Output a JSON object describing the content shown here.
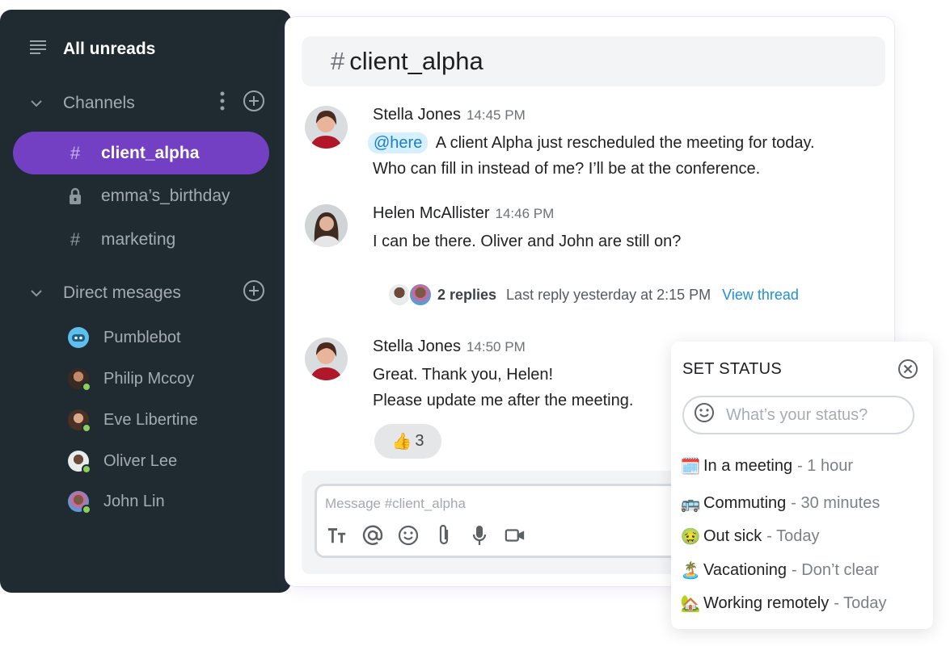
{
  "sidebar": {
    "all_unreads": "All unreads",
    "channels_header": "Channels",
    "channels": [
      {
        "label": "client_alpha",
        "icon": "hash-icon",
        "active": true
      },
      {
        "label": "emma’s_birthday",
        "icon": "lock-icon",
        "active": false
      },
      {
        "label": "marketing",
        "icon": "hash-icon",
        "active": false
      }
    ],
    "dm_header": "Direct mesages",
    "dms": [
      {
        "label": "Pumblebot"
      },
      {
        "label": "Philip Mccoy"
      },
      {
        "label": "Eve Libertine"
      },
      {
        "label": "Oliver Lee"
      },
      {
        "label": "John Lin"
      }
    ]
  },
  "chat": {
    "channel_hash": "#",
    "channel_name": "client_alpha",
    "messages": [
      {
        "author": "Stella Jones",
        "time": "14:45 PM",
        "mention": "@here",
        "line1": "A client Alpha just rescheduled the meeting for today.",
        "line2": "Who can fill in instead of me? I’ll be at the conference."
      },
      {
        "author": "Helen McAllister",
        "time": "14:46 PM",
        "line1": "I can be there. Oliver and John are still on?"
      },
      {
        "author": "Stella Jones",
        "time": "14:50 PM",
        "line1": "Great. Thank you, Helen!",
        "line2": "Please update me after the meeting."
      }
    ],
    "thread": {
      "replies": "2 replies",
      "last_reply": "Last reply yesterday at 2:15 PM",
      "view": "View thread"
    },
    "reaction": {
      "emoji": "👍",
      "count": "3"
    },
    "composer": {
      "placeholder": "Message #client_alpha"
    }
  },
  "status_popup": {
    "title": "SET STATUS",
    "input_placeholder": "What’s your status?",
    "options": [
      {
        "emoji": "🗓️",
        "label": "In a meeting",
        "duration": "- 1 hour"
      },
      {
        "emoji": "🚌",
        "label": "Commuting",
        "duration": " - 30 minutes"
      },
      {
        "emoji": "🤢",
        "label": "Out sick",
        "duration": "- Today"
      },
      {
        "emoji": "🏝️",
        "label": "Vacationing",
        "duration": "- Don’t clear"
      },
      {
        "emoji": "🏡",
        "label": "Working remotely",
        "duration": "- Today"
      }
    ]
  },
  "colors": {
    "sidebar_bg": "#202a31",
    "active_channel": "#7340c4",
    "online_dot": "#8bd05a",
    "link": "#1f8fd6",
    "mention_bg": "#d6f0ff"
  }
}
